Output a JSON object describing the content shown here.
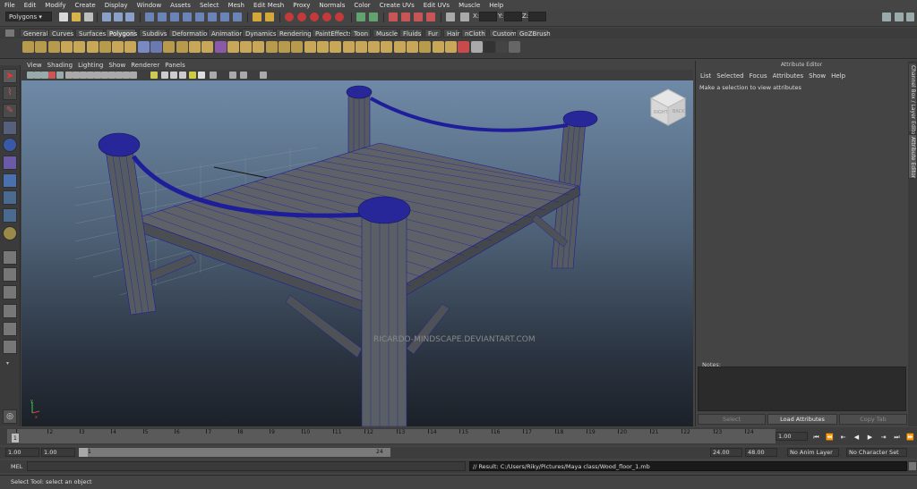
{
  "menubar": [
    "File",
    "Edit",
    "Modify",
    "Create",
    "Display",
    "Window",
    "Assets",
    "Select",
    "Mesh",
    "Edit Mesh",
    "Proxy",
    "Normals",
    "Color",
    "Create UVs",
    "Edit UVs",
    "Muscle",
    "Help"
  ],
  "status_line": {
    "menu_set": "Polygons",
    "coord_labels": {
      "x": "X:",
      "y": "Y:",
      "z": "Z:"
    }
  },
  "shelf_tabs": [
    "General",
    "Curves",
    "Surfaces",
    "Polygons",
    "Subdivs",
    "Deformation",
    "Animation",
    "Dynamics",
    "Rendering",
    "PaintEffects",
    "Toon",
    "Muscle",
    "Fluids",
    "Fur",
    "Hair",
    "nCloth",
    "Custom",
    "GoZBrush"
  ],
  "shelf_active": "Polygons",
  "panel_menu": [
    "View",
    "Shading",
    "Lighting",
    "Show",
    "Renderer",
    "Panels"
  ],
  "viewport": {
    "watermark": "RICARDO-MINDSCAPE.DEVIANTART.COM",
    "viewcube_labels": {
      "front": "RIGHT",
      "side": "BACK"
    },
    "axis_labels": {
      "y": "y",
      "x": "x"
    }
  },
  "attribute_editor": {
    "title": "Attribute Editor",
    "menu": [
      "List",
      "Selected",
      "Focus",
      "Attributes",
      "Show",
      "Help"
    ],
    "message": "Make a selection to view attributes",
    "notes_label": "Notes:",
    "buttons": {
      "select": "Select",
      "load": "Load Attributes",
      "copy": "Copy Tab"
    }
  },
  "side_tabs": [
    "Channel Box / Layer Editor",
    "Attribute Editor"
  ],
  "time_slider": {
    "ticks": [
      "1",
      "2",
      "3",
      "4",
      "5",
      "6",
      "7",
      "8",
      "9",
      "10",
      "11",
      "12",
      "13",
      "14",
      "15",
      "16",
      "17",
      "18",
      "19",
      "20",
      "21",
      "22",
      "23",
      "24"
    ],
    "current_frame": "1",
    "current_time": "1.00"
  },
  "range_slider": {
    "start_time": "1.00",
    "playback_start": "1.00",
    "range_start_label": "1",
    "range_end_label": "24",
    "playback_end": "24.00",
    "end_time": "48.00",
    "anim_layer": "No Anim Layer",
    "character_set": "No Character Set"
  },
  "command_line": {
    "label": "MEL",
    "result": "// Result: C:/Users/Riky/Pictures/Maya class/Wood_floor_1.mb"
  },
  "help_line": "Select Tool: select an object",
  "colors": {
    "accent_blue": "#1e1e9a",
    "wood": "#555a5f",
    "viewport_top": "#6f8aa7",
    "viewport_bottom": "#1c2128"
  }
}
